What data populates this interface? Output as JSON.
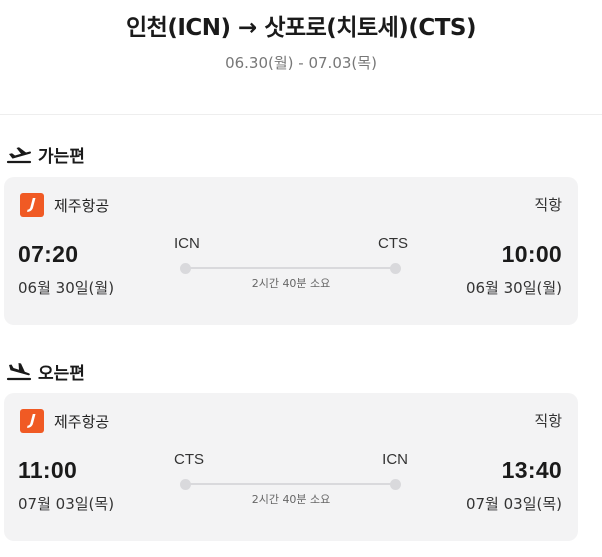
{
  "header": {
    "title": "인천(ICN) → 삿포로(치토세)(CTS)",
    "dates": "06.30(월) - 07.03(목)"
  },
  "sections": [
    {
      "label": "가는편",
      "icon": "plane-takeoff-icon",
      "airline": "제주항공",
      "flight_type": "직항",
      "departure": {
        "time": "07:20",
        "date": "06월 30일(월)",
        "airport": "ICN"
      },
      "arrival": {
        "time": "10:00",
        "date": "06월 30일(월)",
        "airport": "CTS"
      },
      "duration": "2시간 40분 소요"
    },
    {
      "label": "오는편",
      "icon": "plane-landing-icon",
      "airline": "제주항공",
      "flight_type": "직항",
      "departure": {
        "time": "11:00",
        "date": "07월 03일(목)",
        "airport": "CTS"
      },
      "arrival": {
        "time": "13:40",
        "date": "07월 03일(목)",
        "airport": "ICN"
      },
      "duration": "2시간 40분 소요"
    }
  ],
  "colors": {
    "accent": "#f05a24",
    "card_bg": "#f3f3f4",
    "muted_text": "#777777"
  }
}
